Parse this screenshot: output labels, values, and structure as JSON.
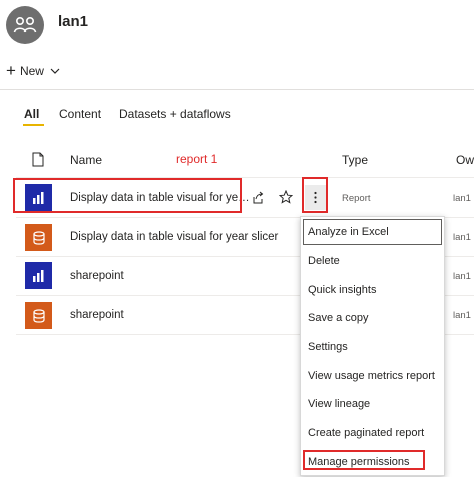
{
  "workspace": {
    "title": "lan1",
    "icon": "people-icon"
  },
  "toolbar": {
    "new_label": "New"
  },
  "tabs": [
    {
      "label": "All",
      "active": true
    },
    {
      "label": "Content",
      "active": false
    },
    {
      "label": "Datasets + dataflows",
      "active": false
    }
  ],
  "table": {
    "headers": {
      "name": "Name",
      "type": "Type",
      "owner": "Own"
    },
    "rows": [
      {
        "name": "Display data in table visual for ye…",
        "type": "Report",
        "owner": "lan1",
        "icon": "report-icon",
        "color": "#1f2aa8"
      },
      {
        "name": "Display data in table visual for year slicer",
        "type": "",
        "owner": "lan1",
        "icon": "dataset-icon",
        "color": "#d35a1a"
      },
      {
        "name": "sharepoint",
        "type": "",
        "owner": "lan1",
        "icon": "report-icon",
        "color": "#1f2aa8"
      },
      {
        "name": "sharepoint",
        "type": "",
        "owner": "lan1",
        "icon": "dataset-icon",
        "color": "#d35a1a"
      }
    ]
  },
  "annotation": {
    "label": "report 1"
  },
  "context_menu": {
    "items": [
      "Analyze in Excel",
      "Delete",
      "Quick insights",
      "Save a copy",
      "Settings",
      "View usage metrics report",
      "View lineage",
      "Create paginated report",
      "Manage permissions"
    ]
  },
  "colors": {
    "annotation": "#e02a2a",
    "tab_underline": "#e8b400",
    "report": "#1f2aa8",
    "dataset": "#d35a1a"
  }
}
